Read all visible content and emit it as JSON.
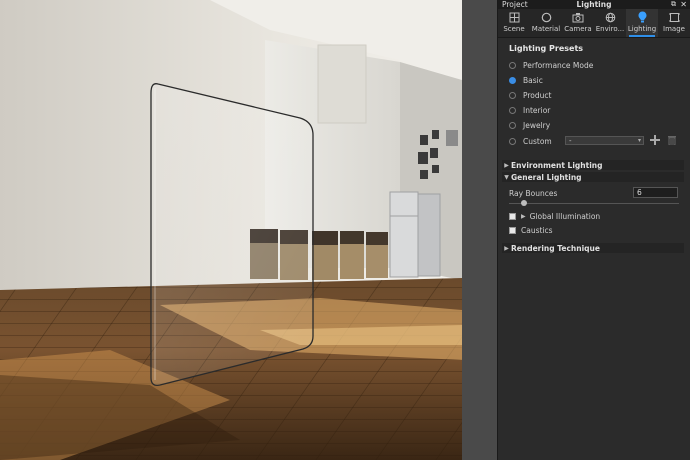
{
  "panel": {
    "project_label": "Project",
    "title": "Lighting",
    "tabs": [
      {
        "label": "Scene",
        "icon": "scene-icon"
      },
      {
        "label": "Material",
        "icon": "material-icon"
      },
      {
        "label": "Camera",
        "icon": "camera-icon"
      },
      {
        "label": "Enviro...",
        "icon": "environment-icon"
      },
      {
        "label": "Lighting",
        "icon": "lighting-icon",
        "active": true
      },
      {
        "label": "Image",
        "icon": "image-icon"
      }
    ],
    "presets_title": "Lighting Presets",
    "presets": [
      {
        "label": "Performance Mode",
        "checked": false
      },
      {
        "label": "Basic",
        "checked": true
      },
      {
        "label": "Product",
        "checked": false
      },
      {
        "label": "Interior",
        "checked": false
      },
      {
        "label": "Jewelry",
        "checked": false
      },
      {
        "label": "Custom",
        "checked": false
      }
    ],
    "custom_select_value": "-",
    "groups": {
      "environment": "Environment Lighting",
      "general": "General Lighting",
      "rendering": "Rendering Technique"
    },
    "ray_bounces_label": "Ray Bounces",
    "ray_bounces_value": "6",
    "ray_bounces_fraction": 0.09,
    "global_illumination_label": "Global Illumination",
    "caustics_label": "Caustics",
    "accent_color": "#2f8fe8"
  }
}
